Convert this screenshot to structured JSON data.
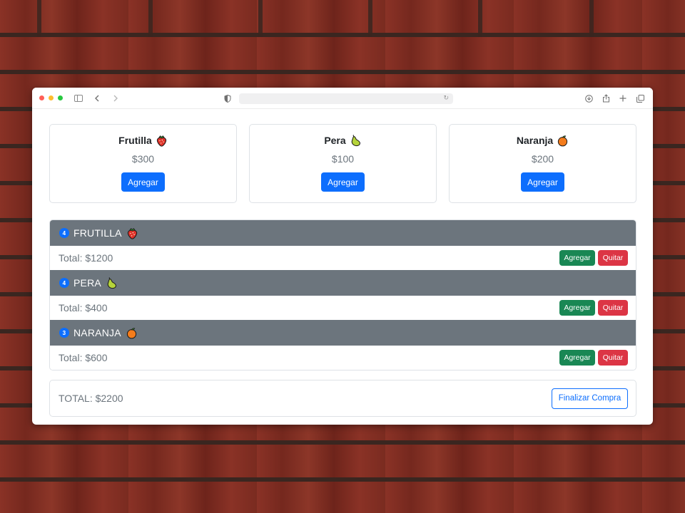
{
  "products": [
    {
      "name": "Frutilla",
      "icon": "strawberry-icon",
      "price": "$300",
      "button": "Agregar"
    },
    {
      "name": "Pera",
      "icon": "pear-icon",
      "price": "$100",
      "button": "Agregar"
    },
    {
      "name": "Naranja",
      "icon": "orange-icon",
      "price": "$200",
      "button": "Agregar"
    }
  ],
  "cart": [
    {
      "qty": "4",
      "name": "FRUTILLA",
      "icon": "strawberry-icon",
      "total": "Total: $1200",
      "add": "Agregar",
      "remove": "Quitar"
    },
    {
      "qty": "4",
      "name": "PERA",
      "icon": "pear-icon",
      "total": "Total: $400",
      "add": "Agregar",
      "remove": "Quitar"
    },
    {
      "qty": "3",
      "name": "NARANJA",
      "icon": "orange-icon",
      "total": "Total: $600",
      "add": "Agregar",
      "remove": "Quitar"
    }
  ],
  "summary": {
    "total": "TOTAL: $2200",
    "checkout": "Finalizar Compra"
  },
  "colors": {
    "primary": "#0d6efd",
    "success": "#198754",
    "danger": "#dc3545",
    "header_gray": "#6c757d"
  }
}
